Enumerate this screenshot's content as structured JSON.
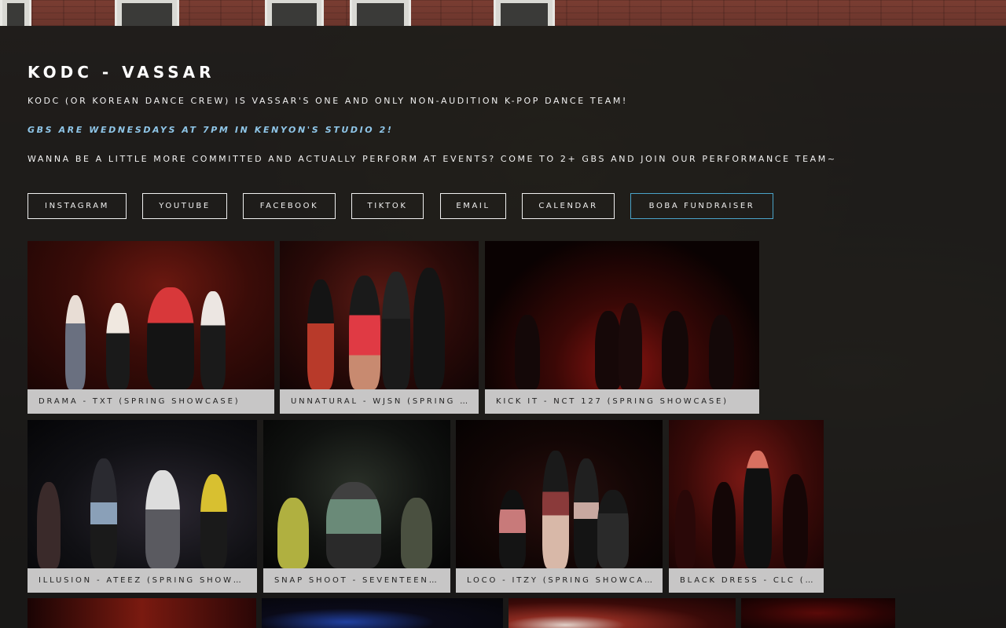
{
  "header": {
    "title": "KODC - VASSAR",
    "line1": "KODC (OR KOREAN DANCE CREW) IS VASSAR'S ONE AND ONLY NON-AUDITION K-POP DANCE TEAM!",
    "line2": "GBS ARE WEDNESDAYS AT 7PM IN KENYON'S STUDIO 2!",
    "line3": "WANNA BE A LITTLE MORE COMMITTED AND ACTUALLY PERFORM AT EVENTS? COME TO 2+ GBS AND JOIN OUR PERFORMANCE TEAM~"
  },
  "buttons": [
    {
      "label": "INSTAGRAM"
    },
    {
      "label": "YOUTUBE"
    },
    {
      "label": "FACEBOOK"
    },
    {
      "label": "TIKTOK"
    },
    {
      "label": "EMAIL"
    },
    {
      "label": "CALENDAR"
    },
    {
      "label": "BOBA FUNDRAISER"
    }
  ],
  "gallery": {
    "row1": [
      {
        "caption": "DRAMA - TXT (SPRING SHOWCASE)"
      },
      {
        "caption": "UNNATURAL - WJSN (SPRING SHOWCASE)"
      },
      {
        "caption": "KICK IT - NCT 127 (SPRING SHOWCASE)"
      }
    ],
    "row2": [
      {
        "caption": "ILLUSION - ATEEZ (SPRING SHOWCASE)"
      },
      {
        "caption": "SNAP SHOOT - SEVENTEEN (SPRING SHOWCASE)"
      },
      {
        "caption": "LOCO - ITZY (SPRING SHOWCASE)"
      },
      {
        "caption": "BLACK DRESS - CLC (SPRING SHOWCASE)"
      }
    ]
  },
  "colors": {
    "accent": "#4aa3c8",
    "highlight_text": "#8fc6e8"
  }
}
